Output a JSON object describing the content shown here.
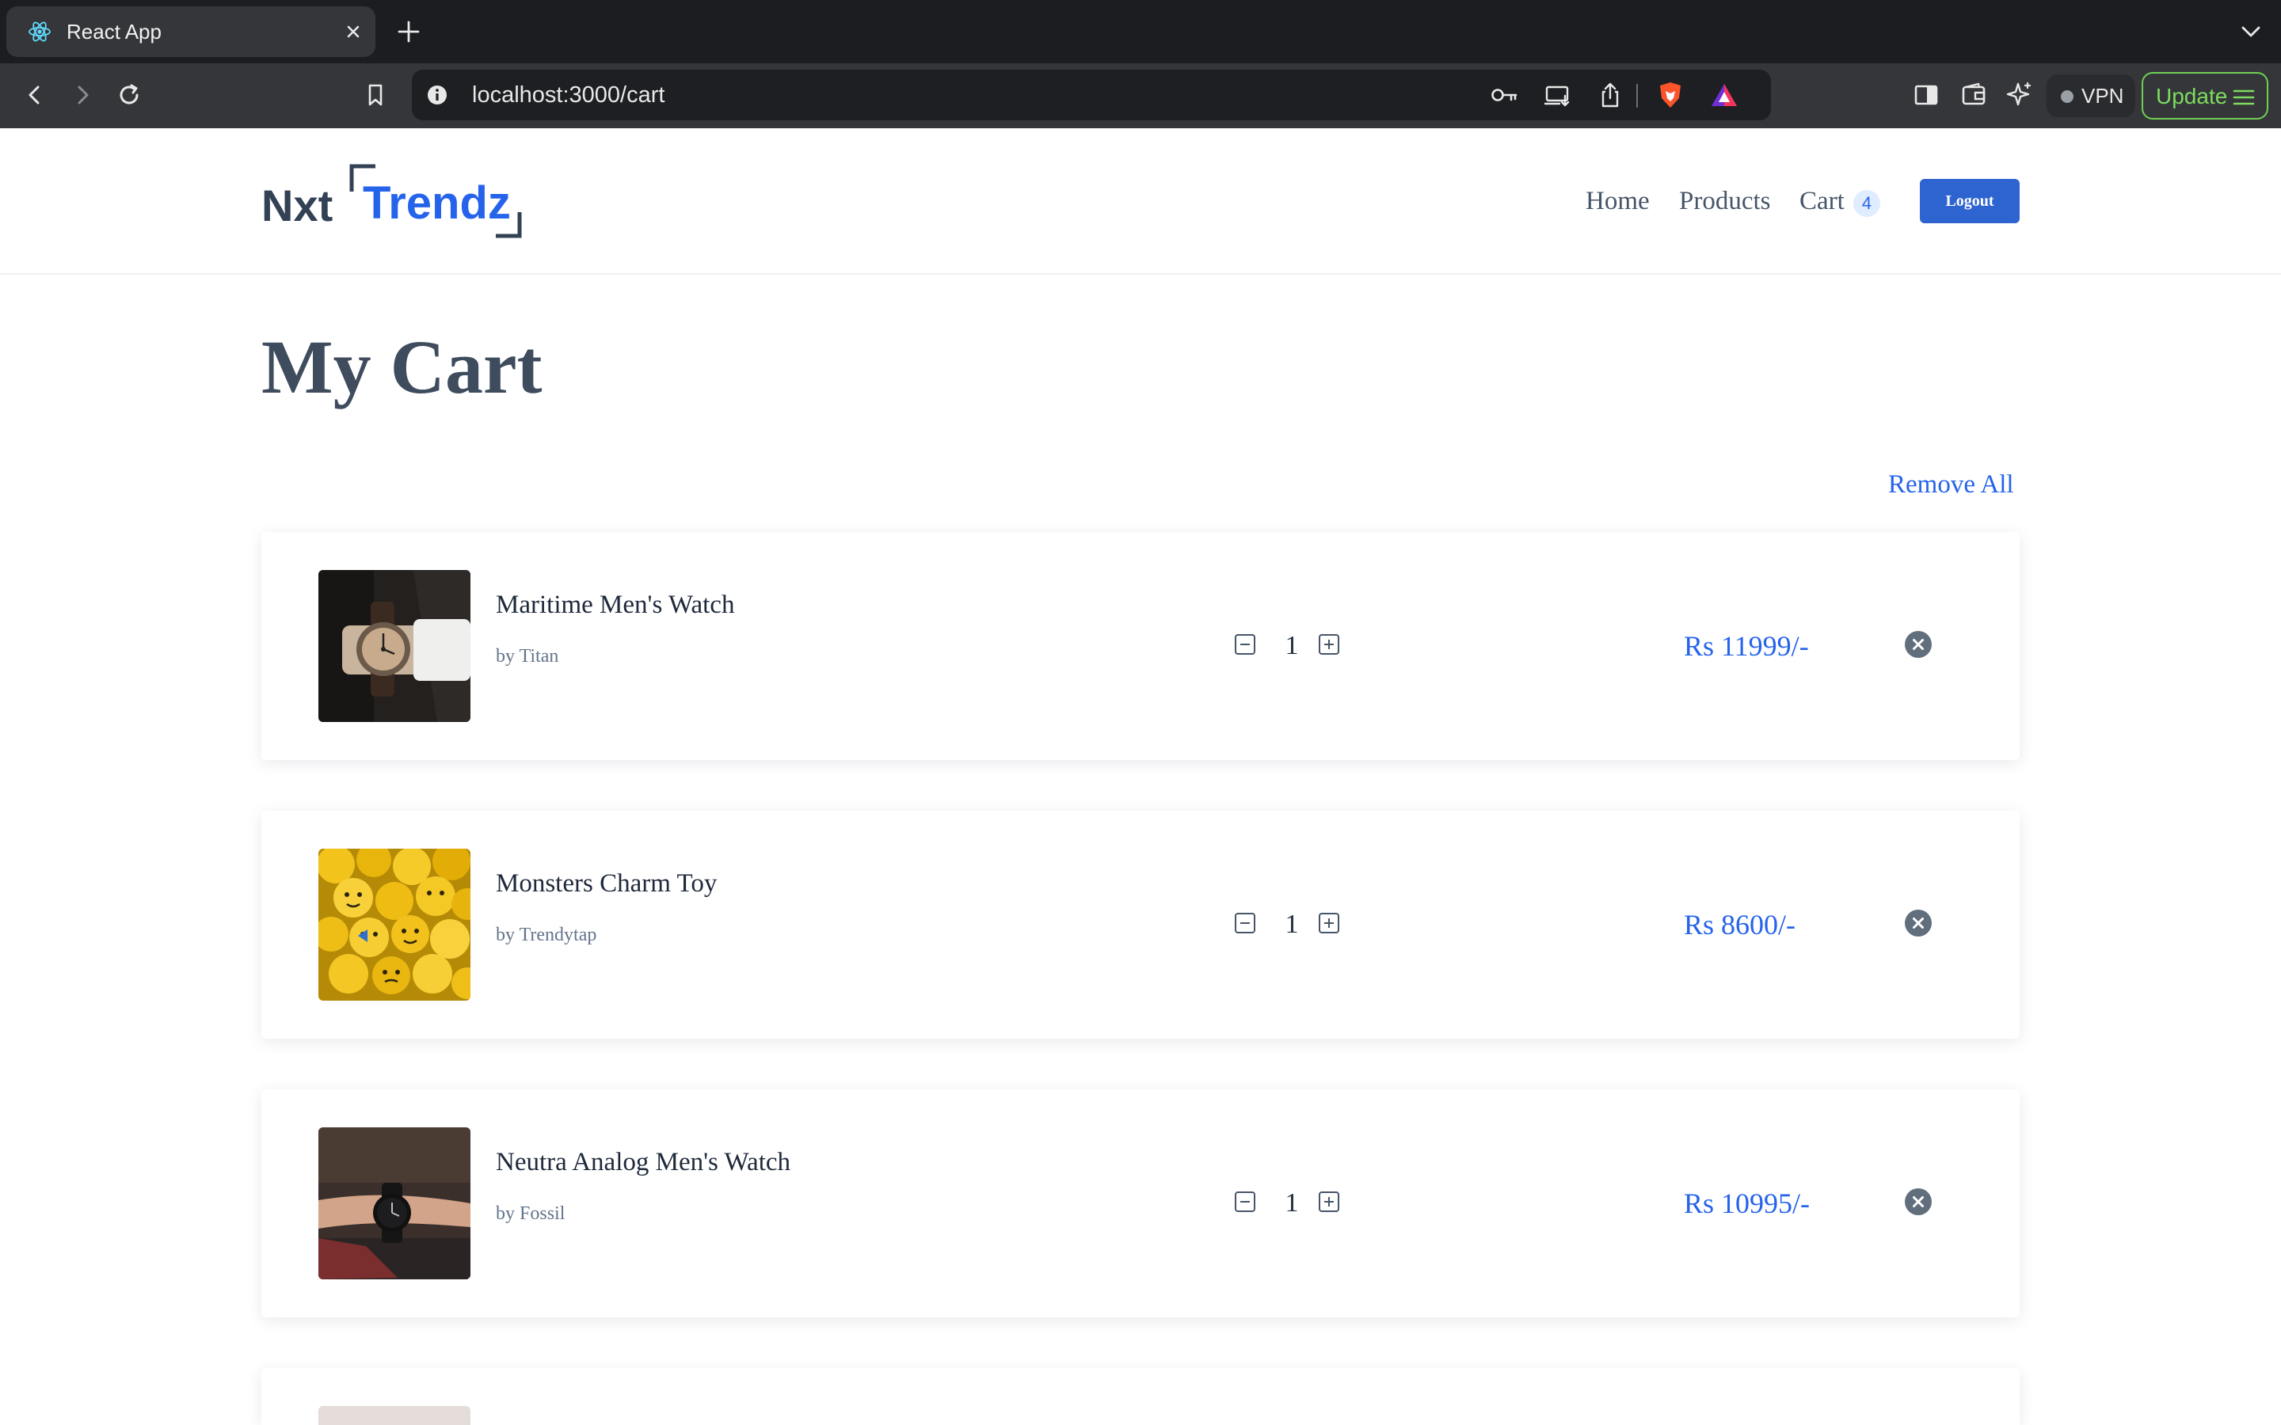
{
  "browser": {
    "tab_title": "React App",
    "url": "localhost:3000/cart",
    "vpn_label": "VPN",
    "update_label": "Update"
  },
  "header": {
    "logo_nxt": "Nxt",
    "logo_trendz": "Trendz",
    "nav": {
      "home": "Home",
      "products": "Products",
      "cart": "Cart",
      "cart_count": "4"
    },
    "logout_label": "Logout"
  },
  "page": {
    "title": "My Cart",
    "remove_all": "Remove All"
  },
  "cart_items": [
    {
      "name": "Maritime Men's Watch",
      "brand": "by Titan",
      "quantity": "1",
      "price": "Rs 11999/-",
      "image": "watch-on-wrist-dark-suit"
    },
    {
      "name": "Monsters Charm Toy",
      "brand": "by Trendytap",
      "quantity": "1",
      "price": "Rs 8600/-",
      "image": "yellow-toy-heads"
    },
    {
      "name": "Neutra Analog Men's Watch",
      "brand": "by Fossil",
      "quantity": "1",
      "price": "Rs 10995/-",
      "image": "black-watch-on-wrist"
    }
  ],
  "colors": {
    "brand_blue": "#2563eb",
    "logout_button": "#2e64d0",
    "heading_text": "#3e4c5e",
    "browser_frame": "#1c1d20"
  }
}
